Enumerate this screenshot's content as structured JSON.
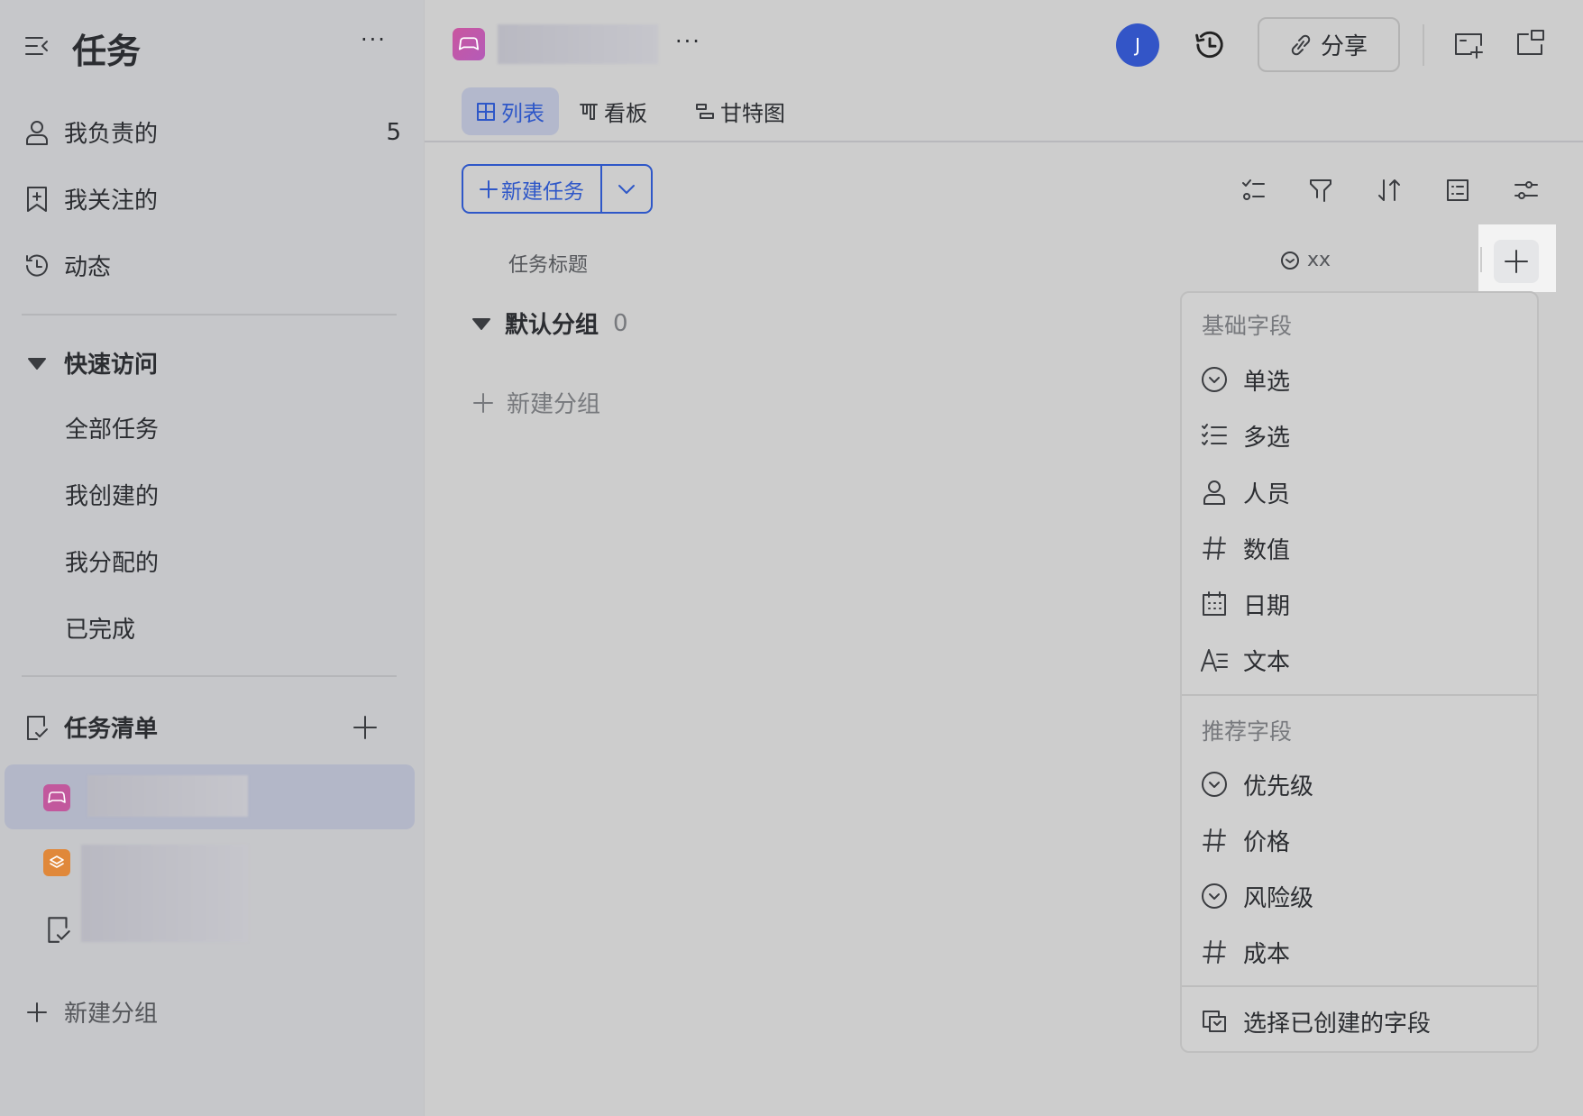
{
  "sidebar": {
    "title": "任务",
    "nav": [
      {
        "label": "我负责的",
        "count": "5",
        "icon": "person-icon"
      },
      {
        "label": "我关注的",
        "icon": "bookmark-icon"
      },
      {
        "label": "动态",
        "icon": "history-icon"
      }
    ],
    "quick_access": {
      "label": "快速访问",
      "items": [
        "全部任务",
        "我创建的",
        "我分配的",
        "已完成"
      ]
    },
    "task_lists": {
      "label": "任务清单"
    },
    "new_group": "新建分组"
  },
  "header": {
    "avatar_initial": "J",
    "share_label": "分享",
    "tabs": [
      {
        "label": "列表",
        "active": true
      },
      {
        "label": "看板"
      },
      {
        "label": "甘特图"
      }
    ]
  },
  "toolbar": {
    "new_task": "新建任务"
  },
  "table": {
    "col_title": "任务标题",
    "col_custom": "xx",
    "group": {
      "name": "默认分组",
      "count": "0"
    },
    "new_group": "新建分组"
  },
  "field_menu": {
    "basic_label": "基础字段",
    "basic": [
      {
        "label": "单选",
        "icon": "single-select-icon"
      },
      {
        "label": "多选",
        "icon": "multi-select-icon"
      },
      {
        "label": "人员",
        "icon": "person-icon"
      },
      {
        "label": "数值",
        "icon": "hash-icon"
      },
      {
        "label": "日期",
        "icon": "calendar-icon"
      },
      {
        "label": "文本",
        "icon": "text-icon"
      }
    ],
    "recommended_label": "推荐字段",
    "recommended": [
      {
        "label": "优先级",
        "icon": "single-select-icon"
      },
      {
        "label": "价格",
        "icon": "hash-icon"
      },
      {
        "label": "风险级",
        "icon": "single-select-icon"
      },
      {
        "label": "成本",
        "icon": "hash-icon"
      }
    ],
    "existing": "选择已创建的字段"
  },
  "colors": {
    "accent": "#2e57c8",
    "avatar": "#3355c7",
    "list_icon": "#c2589d",
    "list_icon2": "#e0883a"
  }
}
